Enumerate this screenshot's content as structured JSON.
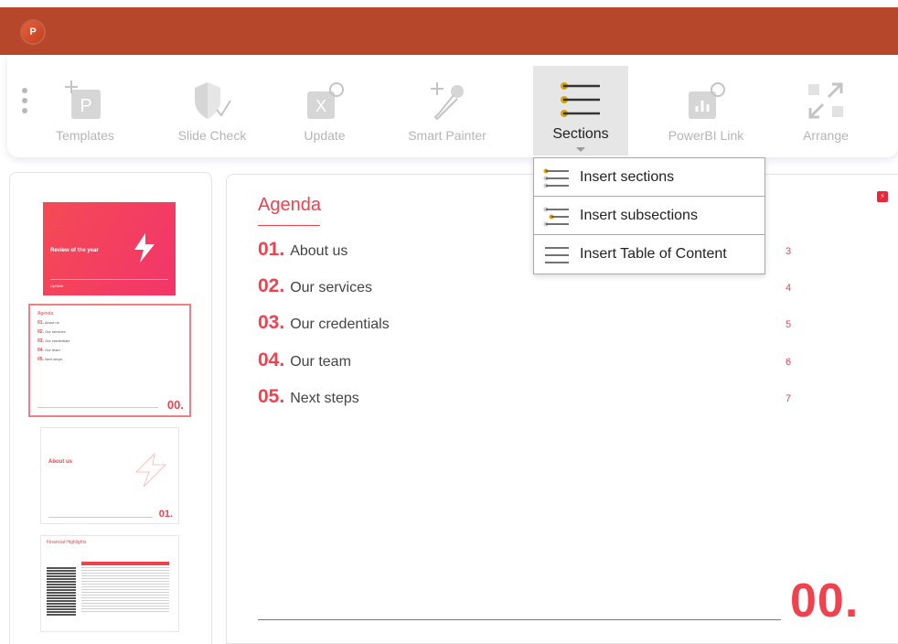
{
  "app": {
    "logo_letter": "P"
  },
  "ribbon": {
    "tools": [
      {
        "id": "templates",
        "label": "Templates",
        "icon": "templates-icon"
      },
      {
        "id": "slide-check",
        "label": "Slide Check",
        "icon": "shield-check-icon"
      },
      {
        "id": "update",
        "label": "Update",
        "icon": "excel-refresh-icon"
      },
      {
        "id": "smart-painter",
        "label": "Smart Painter",
        "icon": "eyedropper-icon"
      },
      {
        "id": "sections",
        "label": "Sections",
        "icon": "sections-list-icon",
        "active": true
      },
      {
        "id": "powerbi-link",
        "label": "PowerBI Link",
        "icon": "powerbi-icon"
      },
      {
        "id": "arrange",
        "label": "Arrange",
        "icon": "arrange-icon"
      }
    ]
  },
  "sections_menu": {
    "items": [
      {
        "label": "Insert sections",
        "icon": "insert-sections-icon"
      },
      {
        "label": "Insert subsections",
        "icon": "insert-subsections-icon"
      },
      {
        "label": "Insert Table of Content",
        "icon": "table-of-content-icon"
      }
    ]
  },
  "thumbnails": {
    "slide1": {
      "title": "Review of the year",
      "brand": "UpSlide"
    },
    "slide2": {
      "title": "Agenda",
      "rows": [
        {
          "num": "01.",
          "text": "About us"
        },
        {
          "num": "02.",
          "text": "Our services"
        },
        {
          "num": "03.",
          "text": "Our credentials"
        },
        {
          "num": "04.",
          "text": "Our team"
        },
        {
          "num": "05.",
          "text": "Next steps"
        }
      ],
      "section_number": "00."
    },
    "slide3": {
      "title": "About us",
      "section_number": "01."
    },
    "slide4": {
      "title": "Financial Highlights"
    }
  },
  "slide": {
    "title": "Agenda",
    "items": [
      {
        "num": "01.",
        "text": "About us",
        "page": "3"
      },
      {
        "num": "02.",
        "text": "Our services",
        "page": "4"
      },
      {
        "num": "03.",
        "text": "Our credentials",
        "page": "5"
      },
      {
        "num": "04.",
        "text": "Our team",
        "page": "6"
      },
      {
        "num": "05.",
        "text": "Next steps",
        "page": "7"
      }
    ],
    "section_number": "00."
  },
  "colors": {
    "titlebar": "#b7472a",
    "accent": "#f0424e",
    "bullet_yellow": "#d9a300"
  }
}
